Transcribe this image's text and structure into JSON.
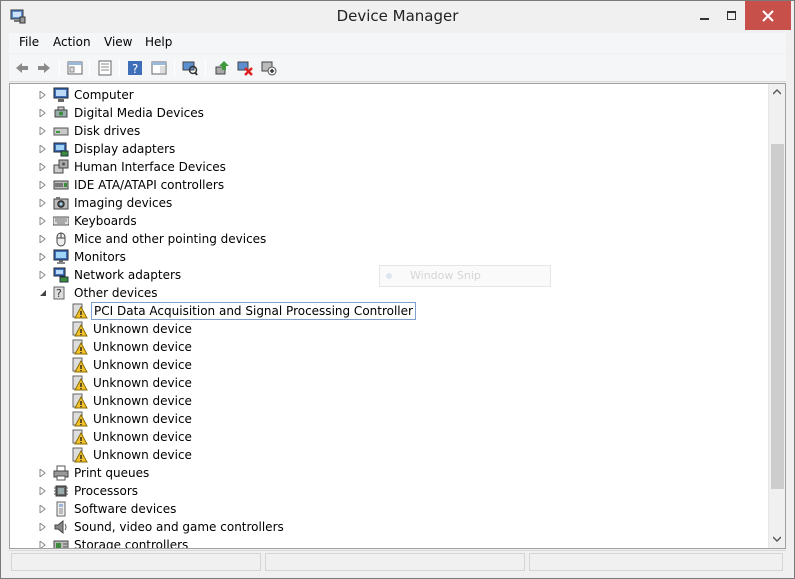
{
  "window": {
    "title": "Device Manager"
  },
  "menu": [
    "File",
    "Action",
    "View",
    "Help"
  ],
  "toolbar": {
    "icons": [
      "back-arrow-icon",
      "forward-arrow-icon",
      "show-hide-console-tree-icon",
      "properties-icon",
      "help-icon",
      "action-pane-icon",
      "scan-hardware-changes-icon",
      "update-driver-icon",
      "uninstall-device-icon",
      "add-legacy-hardware-icon"
    ]
  },
  "tree": {
    "categories": [
      {
        "label": "Computer",
        "icon": "computer-icon",
        "expanded": false
      },
      {
        "label": "Digital Media Devices",
        "icon": "media-device-icon",
        "expanded": false
      },
      {
        "label": "Disk drives",
        "icon": "disk-drive-icon",
        "expanded": false
      },
      {
        "label": "Display adapters",
        "icon": "display-adapter-icon",
        "expanded": false
      },
      {
        "label": "Human Interface Devices",
        "icon": "hid-icon",
        "expanded": false
      },
      {
        "label": "IDE ATA/ATAPI controllers",
        "icon": "ide-controller-icon",
        "expanded": false
      },
      {
        "label": "Imaging devices",
        "icon": "camera-icon",
        "expanded": false
      },
      {
        "label": "Keyboards",
        "icon": "keyboard-icon",
        "expanded": false
      },
      {
        "label": "Mice and other pointing devices",
        "icon": "mouse-icon",
        "expanded": false
      },
      {
        "label": "Monitors",
        "icon": "monitor-icon",
        "expanded": false
      },
      {
        "label": "Network adapters",
        "icon": "network-adapter-icon",
        "expanded": false
      },
      {
        "label": "Other devices",
        "icon": "unknown-device-icon",
        "expanded": true,
        "children": [
          "PCI Data Acquisition and Signal Processing Controller",
          "Unknown device",
          "Unknown device",
          "Unknown device",
          "Unknown device",
          "Unknown device",
          "Unknown device",
          "Unknown device",
          "Unknown device"
        ]
      },
      {
        "label": "Print queues",
        "icon": "printer-icon",
        "expanded": false
      },
      {
        "label": "Processors",
        "icon": "processor-icon",
        "expanded": false
      },
      {
        "label": "Software devices",
        "icon": "software-device-icon",
        "expanded": false
      },
      {
        "label": "Sound, video and game controllers",
        "icon": "speaker-icon",
        "expanded": false
      },
      {
        "label": "Storage controllers",
        "icon": "storage-controller-icon",
        "expanded": false
      }
    ],
    "selected_child": 0
  },
  "overlay": {
    "label": "Window Snip"
  },
  "colors": {
    "close_button": "#c7504b",
    "warning": "#f2c12e",
    "selection_border": "#7da2ce"
  }
}
